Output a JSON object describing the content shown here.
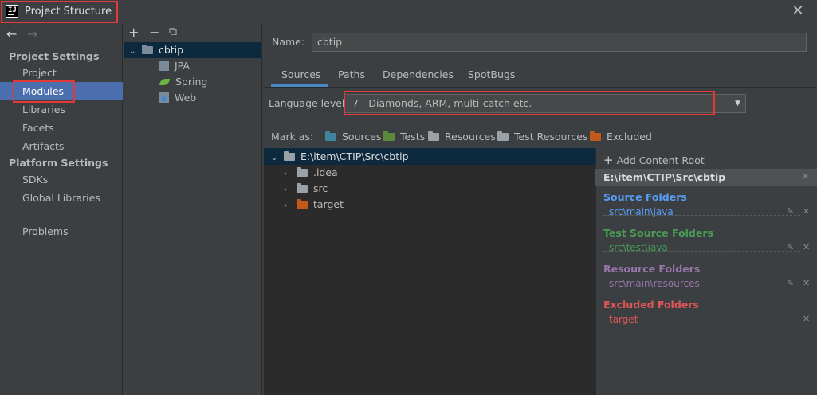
{
  "window": {
    "title": "Project Structure",
    "close_glyph": "✕"
  },
  "nav": {
    "back": "←",
    "forward": "→"
  },
  "sidebar": {
    "project_settings_heading": "Project Settings",
    "platform_settings_heading": "Platform Settings",
    "items": [
      {
        "label": "Project"
      },
      {
        "label": "Modules",
        "selected": true
      },
      {
        "label": "Libraries"
      },
      {
        "label": "Facets"
      },
      {
        "label": "Artifacts"
      },
      {
        "label": "SDKs"
      },
      {
        "label": "Global Libraries"
      },
      {
        "label": "Problems"
      }
    ]
  },
  "module_toolbar": {
    "add": "+",
    "remove": "−",
    "copy": "⧉"
  },
  "module_tree": {
    "root": "cbtip",
    "children": [
      {
        "label": "JPA",
        "icon": "jpa-icon"
      },
      {
        "label": "Spring",
        "icon": "spring-leaf-icon"
      },
      {
        "label": "Web",
        "icon": "web-icon"
      }
    ]
  },
  "name_field": {
    "label": "Name:",
    "value": "cbtip"
  },
  "tabs": [
    "Sources",
    "Paths",
    "Dependencies",
    "SpotBugs"
  ],
  "language_level": {
    "label": "Language level:",
    "value": "7 - Diamonds, ARM, multi-catch etc."
  },
  "mark_as": {
    "label": "Mark as:",
    "items": [
      {
        "label": "Sources",
        "color": "#3e86a0"
      },
      {
        "label": "Tests",
        "color": "#5b8a3c"
      },
      {
        "label": "Resources",
        "color": "#9aa2a7"
      },
      {
        "label": "Test Resources",
        "color": "#9aa2a7"
      },
      {
        "label": "Excluded",
        "color": "#c1581c"
      }
    ]
  },
  "file_tree": {
    "root": "E:\\item\\CTIP\\Src\\cbtip",
    "children": [
      {
        "label": ".idea",
        "color": "#9aa2a7"
      },
      {
        "label": "src",
        "color": "#9aa2a7"
      },
      {
        "label": "target",
        "color": "#c1581c"
      }
    ]
  },
  "content_root": {
    "add_label": "Add Content Root",
    "path": "E:\\item\\CTIP\\Src\\cbtip",
    "source_folders": {
      "heading": "Source Folders",
      "value": "src\\main\\java",
      "color": "#589df6"
    },
    "test_source_folders": {
      "heading": "Test Source Folders",
      "value": "src\\test\\java",
      "color": "#499c54"
    },
    "resource_folders": {
      "heading": "Resource Folders",
      "value": "src\\main\\resources",
      "color": "#9876aa"
    },
    "excluded_folders": {
      "heading": "Excluded Folders",
      "value": "target",
      "color": "#e05555"
    }
  },
  "colors": {
    "selection": "#4b6eaf",
    "annotation_red": "#e53935",
    "tab_underline": "#4a88c7"
  }
}
